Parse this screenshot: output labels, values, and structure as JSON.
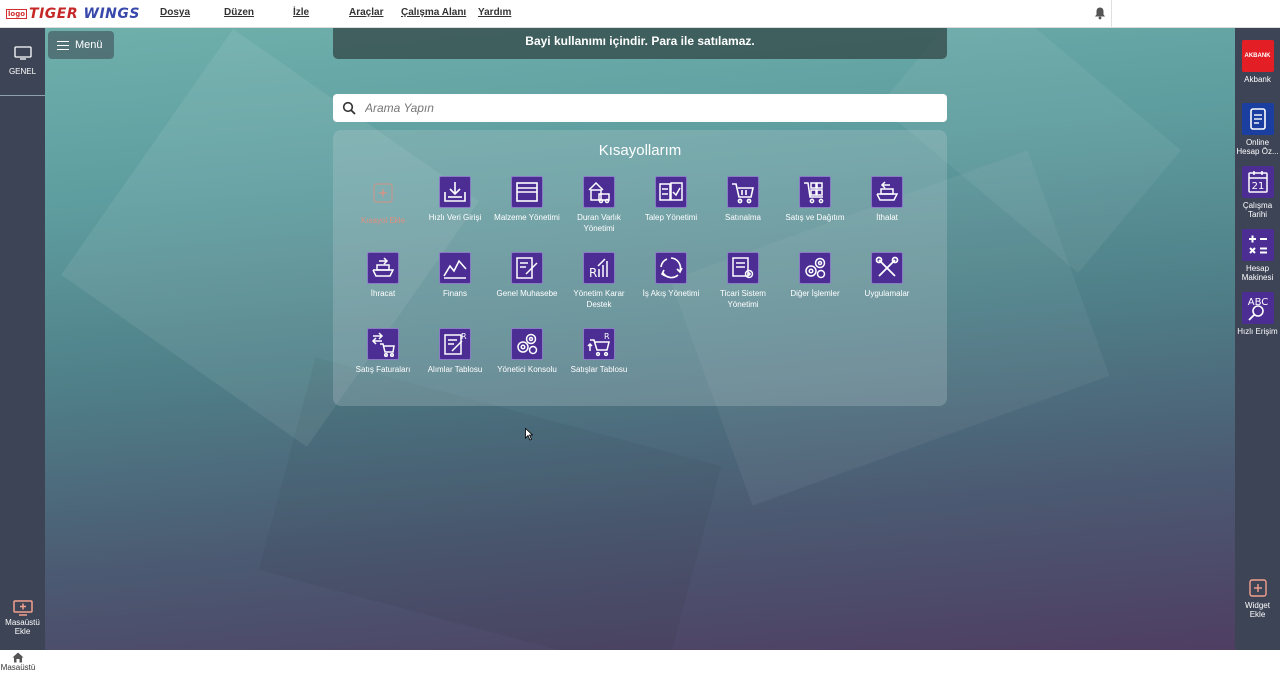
{
  "app": {
    "logo_prefix": "logo",
    "logo_tiger": "TIGER",
    "logo_wings": "WINGS"
  },
  "menu": [
    {
      "label": "Dosya"
    },
    {
      "label": "Düzen"
    },
    {
      "label": "İzle"
    },
    {
      "label": "Araçlar"
    },
    {
      "label": "Çalışma Alanı"
    },
    {
      "label": "Yardım"
    }
  ],
  "notice": "Bayi kullanımı içindir. Para ile satılamaz.",
  "menu_button": "Menü",
  "search": {
    "placeholder": "Arama Yapın",
    "value": ""
  },
  "left_rail": {
    "tab_label": "GENEL",
    "add_desktop": "Masaüstü Ekle"
  },
  "taskbar": {
    "home_label": "Masaüstü"
  },
  "shortcuts": {
    "title": "Kısayollarım",
    "add_label": "Kısayol Ekle",
    "items": [
      {
        "label": "Hızlı Veri Girişi",
        "icon": "download-icon"
      },
      {
        "label": "Malzeme Yönetimi",
        "icon": "window-icon"
      },
      {
        "label": "Duran Varlık Yönetimi",
        "icon": "house-truck-icon"
      },
      {
        "label": "Talep Yönetimi",
        "icon": "checklist-icon"
      },
      {
        "label": "Satınalma",
        "icon": "cart-icon"
      },
      {
        "label": "Satış ve Dağıtım",
        "icon": "cart-boxes-icon"
      },
      {
        "label": "İthalat",
        "icon": "ship-in-icon"
      },
      {
        "label": "İhracat",
        "icon": "ship-out-icon"
      },
      {
        "label": "Finans",
        "icon": "line-chart-icon"
      },
      {
        "label": "Genel Muhasebe",
        "icon": "ledger-edit-icon"
      },
      {
        "label": "Yönetim Karar Destek",
        "icon": "report-chart-icon"
      },
      {
        "label": "İş Akış Yönetimi",
        "icon": "recycle-icon"
      },
      {
        "label": "Ticari Sistem Yönetimi",
        "icon": "document-gear-icon"
      },
      {
        "label": "Diğer İşlemler",
        "icon": "gears-icon"
      },
      {
        "label": "Uygulamalar",
        "icon": "tools-icon"
      },
      {
        "label": "Satış Faturaları",
        "icon": "cart-exchange-icon"
      },
      {
        "label": "Alımlar Tablosu",
        "icon": "table-edit-icon"
      },
      {
        "label": "Yönetici Konsolu",
        "icon": "gears-icon"
      },
      {
        "label": "Satışlar Tablosu",
        "icon": "cart-report-icon"
      }
    ]
  },
  "widgets": [
    {
      "label": "Akbank",
      "icon": "akbank-logo",
      "logo_text": "AKBANK",
      "color": "#e31e24"
    },
    {
      "label": "Online Hesap Öz...",
      "icon": "document-icon",
      "color": "#1a3fa0"
    },
    {
      "label": "Çalışma Tarihi",
      "icon": "calendar-icon",
      "day": "21",
      "color": "#4b2d94"
    },
    {
      "label": "Hesap Makinesi",
      "icon": "calculator-icon",
      "color": "#4b2d94"
    },
    {
      "label": "Hızlı Erişim",
      "icon": "abc-search-icon",
      "icon_text": "ABC",
      "color": "#4b2d94"
    },
    {
      "label": "Widget Ekle",
      "icon": "plus-icon"
    }
  ]
}
